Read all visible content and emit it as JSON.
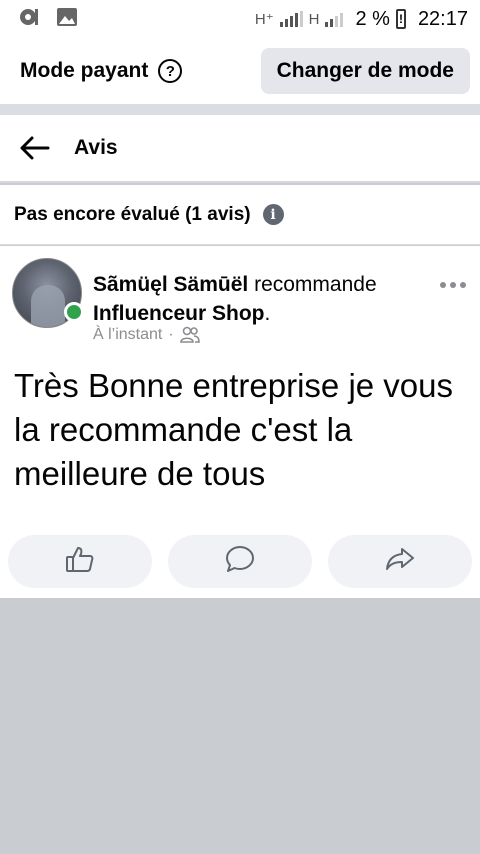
{
  "status_bar": {
    "net1": "H⁺",
    "net2": "H",
    "battery_percent": "2 %",
    "battery_mark": "!",
    "time": "22:17",
    "icons": [
      "podcast-icon",
      "image-icon",
      "signal-icon",
      "battery-icon"
    ]
  },
  "mode_bar": {
    "label": "Mode payant",
    "help": "?",
    "switch_button": "Changer de mode"
  },
  "header": {
    "title": "Avis"
  },
  "rating": {
    "text": "Pas encore évalué (1 avis)",
    "info": "i"
  },
  "post": {
    "author": "Sãmüęl Sämūël",
    "verb": "recommande",
    "page": "Influenceur Shop",
    "period": ".",
    "time": "À l’instant",
    "separator": "·",
    "text": "Très Bonne entreprise je vous la recommande c'est la meilleure de tous",
    "online_color": "#31a24c"
  },
  "actions": {
    "icons": [
      "like-icon",
      "comment-icon",
      "share-icon"
    ]
  }
}
